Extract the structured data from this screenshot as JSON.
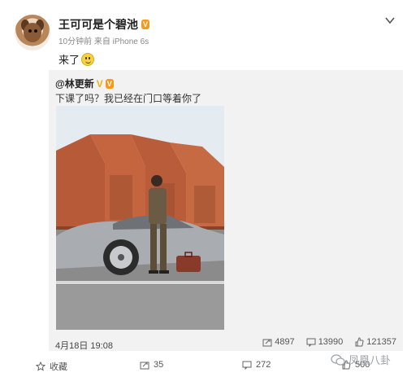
{
  "post": {
    "username": "王可可是个碧池",
    "badge": "vip",
    "meta": "10分钟前 来自 iPhone 6s",
    "text": "来了"
  },
  "repost": {
    "ref_user": "@林更新",
    "ref_text": "下课了吗？我已经在门口等着你了",
    "date": "4月18日 19:08",
    "stats": {
      "reposts": "4897",
      "comments": "13990",
      "likes": "121357"
    }
  },
  "bottom_bar": {
    "favorite": "收藏",
    "repost": "35",
    "comment": "272",
    "like": "500"
  },
  "watermark": "凤凰八卦",
  "icons": [
    "chevron-down-icon",
    "smiley-icon",
    "repost-icon",
    "comment-icon",
    "like-icon",
    "star-icon",
    "wechat-icon"
  ]
}
